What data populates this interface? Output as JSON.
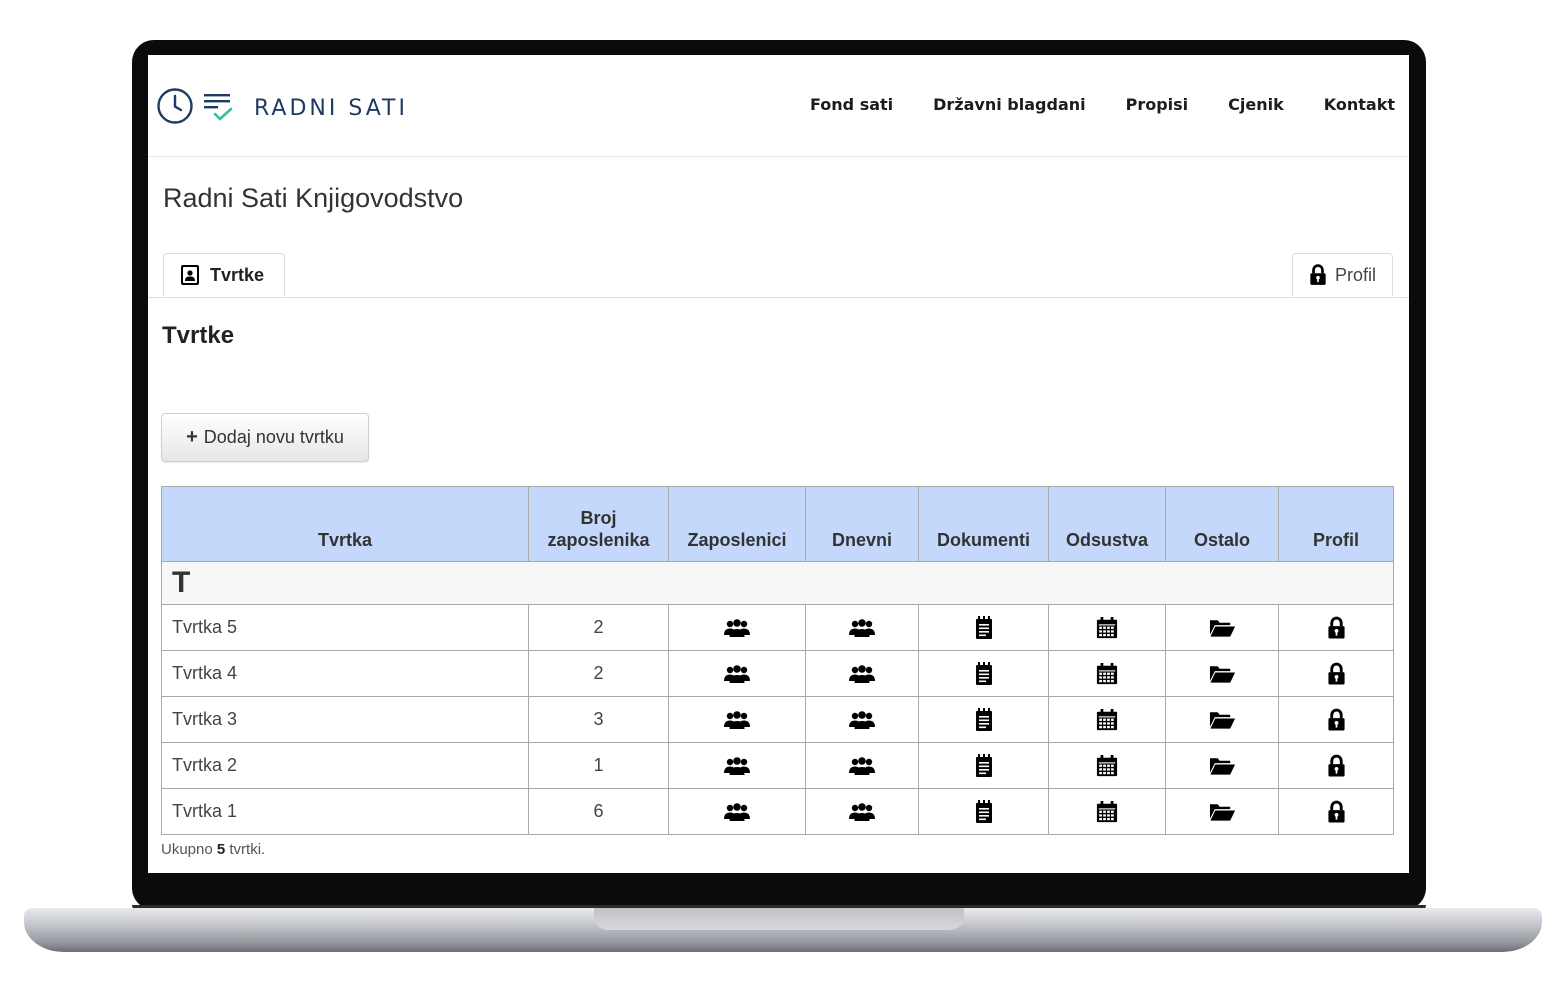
{
  "brand": {
    "name": "RADNI SATI",
    "clock_icon": "clock-icon",
    "checklist_icon": "checklist-icon",
    "accent": "#1f3a63",
    "check_color": "#2fbfa7"
  },
  "nav": [
    {
      "label": "Fond sati"
    },
    {
      "label": "Državni blagdani"
    },
    {
      "label": "Propisi"
    },
    {
      "label": "Cjenik"
    },
    {
      "label": "Kontakt"
    }
  ],
  "page": {
    "title": "Radni Sati Knjigovodstvo"
  },
  "tabs": {
    "firms": "Tvrtke",
    "profile": "Profil"
  },
  "section": {
    "title": "Tvrtke",
    "add_button": "Dodaj novu tvrtku"
  },
  "table": {
    "headers": {
      "firm": "Tvrtka",
      "employees_count_line1": "Broj",
      "employees_count_line2": "zaposlenika",
      "employees": "Zaposlenici",
      "daily": "Dnevni",
      "documents": "Dokumenti",
      "absences": "Odsustva",
      "other": "Ostalo",
      "profile": "Profil"
    },
    "header_bg": "#c3d8fa",
    "group_letter": "T",
    "rows": [
      {
        "name": "Tvrtka 5",
        "count": "2"
      },
      {
        "name": "Tvrtka 4",
        "count": "2"
      },
      {
        "name": "Tvrtka 3",
        "count": "3"
      },
      {
        "name": "Tvrtka 2",
        "count": "1"
      },
      {
        "name": "Tvrtka 1",
        "count": "6"
      }
    ]
  },
  "footer": {
    "prefix": "Ukupno",
    "total": "5",
    "suffix": "tvrtki."
  }
}
